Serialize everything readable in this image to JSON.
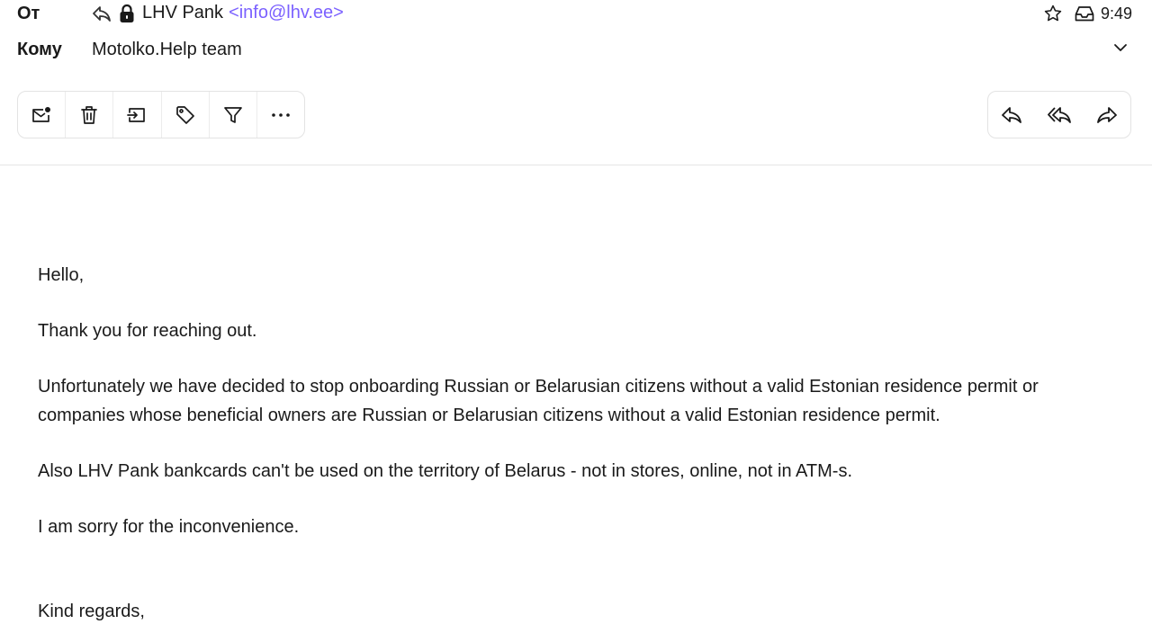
{
  "header": {
    "from_label": "От",
    "sender_name": "LHV Pank",
    "sender_email": "<info@lhv.ee>",
    "to_label": "Кому",
    "recipient": "Motolko.Help team",
    "time": "9:49",
    "icons": [
      "replied-icon",
      "lock-icon",
      "star-icon",
      "inbox-icon",
      "chevron-down-icon"
    ]
  },
  "toolbar": {
    "actions": [
      {
        "name": "mark-unread",
        "icon": "envelope-dot-icon"
      },
      {
        "name": "delete",
        "icon": "trash-icon"
      },
      {
        "name": "move",
        "icon": "move-to-folder-icon"
      },
      {
        "name": "tag",
        "icon": "tag-icon"
      },
      {
        "name": "filter",
        "icon": "filter-icon"
      },
      {
        "name": "more",
        "icon": "more-icon"
      }
    ],
    "reply_actions": [
      {
        "name": "reply",
        "icon": "reply-icon"
      },
      {
        "name": "reply-all",
        "icon": "reply-all-icon"
      },
      {
        "name": "forward",
        "icon": "forward-icon"
      }
    ]
  },
  "message": {
    "greeting": "Hello,",
    "thanks": "Thank you for reaching out.",
    "main": "Unfortunately we have decided to stop onboarding Russian or Belarusian citizens without a valid Estonian residence permit or companies whose beneficial owners are Russian or Belarusian citizens without a valid Estonian residence permit.",
    "also": "Also LHV Pank bankcards can't be used on the territory of Belarus - not in stores, online, not in ATM-s.",
    "sorry": "I am sorry for the inconvenience.",
    "regards": "Kind regards,"
  },
  "colors": {
    "accent": "#7b61ff",
    "text": "#1a1a1a",
    "border": "#e3e3e3"
  }
}
